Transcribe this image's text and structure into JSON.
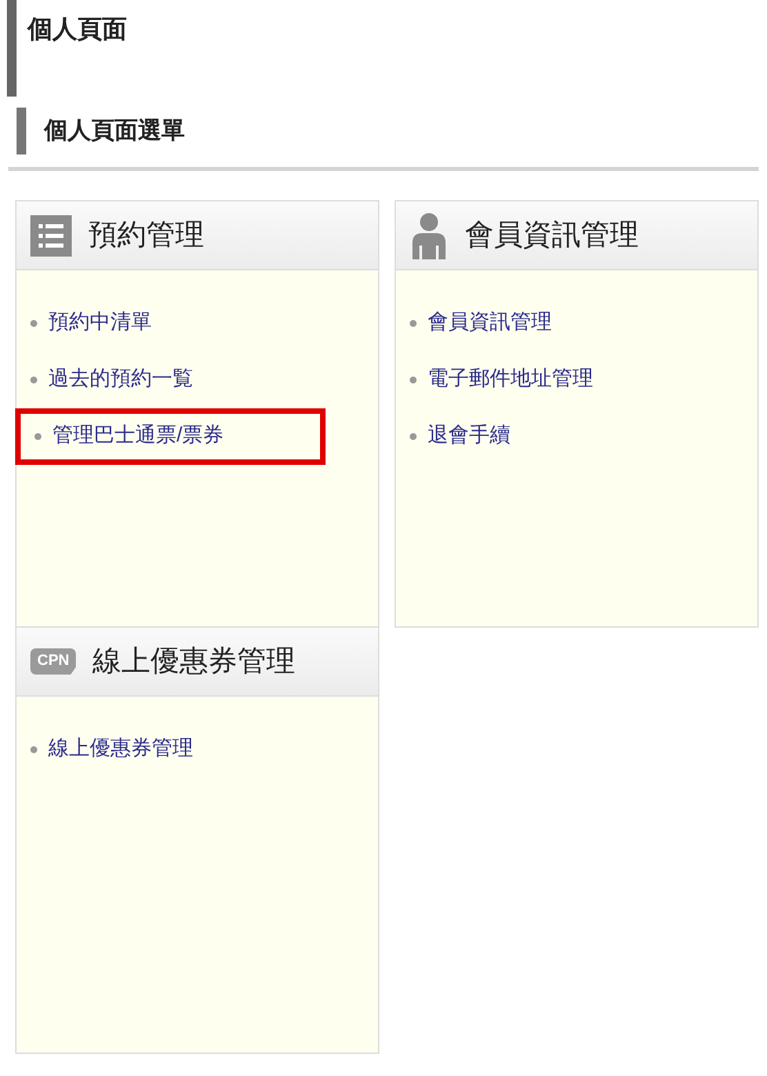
{
  "page_title": "個人頁面",
  "section_title": "個人頁面選單",
  "cards": [
    {
      "kind": "list",
      "title": "預約管理",
      "items": [
        {
          "label": "預約中清單",
          "highlighted": false
        },
        {
          "label": "過去的預約一覧",
          "highlighted": false
        },
        {
          "label": "管理巴士通票/票券",
          "highlighted": true
        }
      ]
    },
    {
      "kind": "person",
      "title": "會員資訊管理",
      "items": [
        {
          "label": "會員資訊管理",
          "highlighted": false
        },
        {
          "label": "電子郵件地址管理",
          "highlighted": false
        },
        {
          "label": "退會手續",
          "highlighted": false
        }
      ]
    },
    {
      "kind": "coupon",
      "icon_text": "CPN",
      "title": "線上優惠券管理",
      "items": [
        {
          "label": "線上優惠券管理",
          "highlighted": false
        }
      ]
    }
  ]
}
